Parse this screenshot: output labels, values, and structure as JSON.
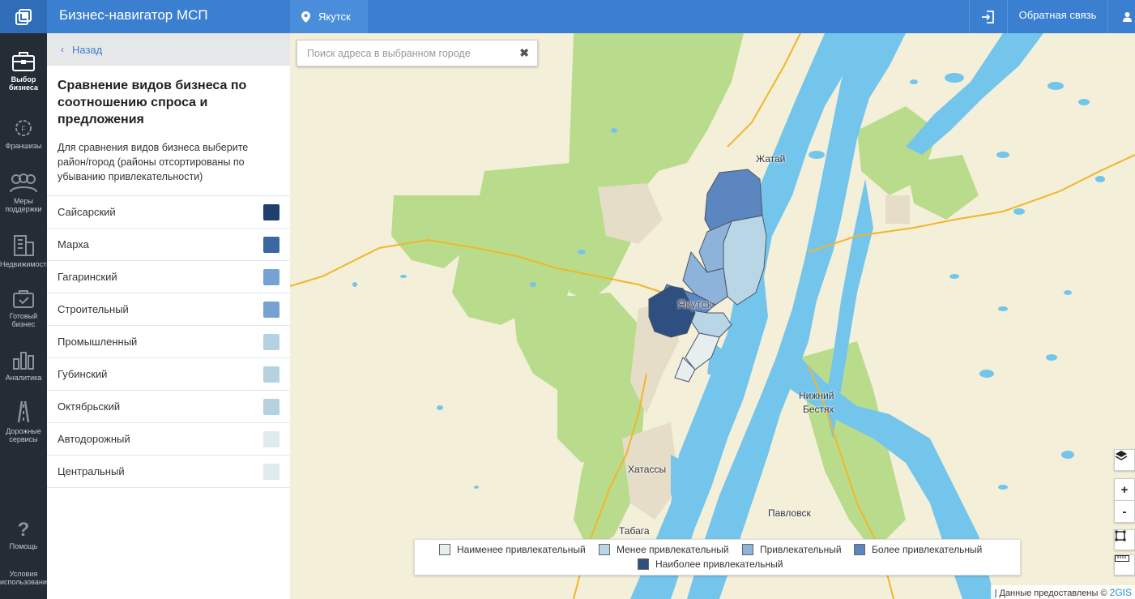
{
  "header": {
    "app_title": "Бизнес-навигатор МСП",
    "city": "Якутск",
    "feedback": "Обратная связь"
  },
  "rail": [
    {
      "label1": "Выбор",
      "label2": "бизнеса",
      "icon": "briefcase-icon",
      "active": true
    },
    {
      "label1": "Франшизы",
      "label2": "",
      "icon": "franchise-gear-icon",
      "active": false
    },
    {
      "label1": "Меры",
      "label2": "поддержки",
      "icon": "people-icon",
      "active": false
    },
    {
      "label1": "Недвижимость",
      "label2": "",
      "icon": "building-icon",
      "active": false
    },
    {
      "label1": "Готовый",
      "label2": "бизнес",
      "icon": "ready-business-icon",
      "active": false
    },
    {
      "label1": "Аналитика",
      "label2": "",
      "icon": "analytics-chart-icon",
      "active": false
    },
    {
      "label1": "Дорожные",
      "label2": "сервисы",
      "icon": "road-icon",
      "active": false
    },
    {
      "label1": "Помощь",
      "label2": "",
      "icon": "help-icon",
      "active": false
    },
    {
      "label1": "Условия",
      "label2": "использования",
      "icon": "",
      "active": false
    }
  ],
  "panel": {
    "back": "Назад",
    "title": "Сравнение видов бизнеса по соотношению спроса и предложения",
    "description": "Для сравнения видов бизнеса выберите район/город (районы отсортированы по убыванию привлекательности)",
    "districts": [
      {
        "name": "Сайсарский",
        "color": "#1f3f6e"
      },
      {
        "name": "Марха",
        "color": "#3c67a4"
      },
      {
        "name": "Гагаринский",
        "color": "#74a3d3"
      },
      {
        "name": "Строительный",
        "color": "#74a3d3"
      },
      {
        "name": "Промышленный",
        "color": "#b4d2e2"
      },
      {
        "name": "Губинский",
        "color": "#b4d2e2"
      },
      {
        "name": "Октябрьский",
        "color": "#b4d2e2"
      },
      {
        "name": "Автодорожный",
        "color": "#e0ebec"
      },
      {
        "name": "Центральный",
        "color": "#e0ebec"
      }
    ]
  },
  "map": {
    "search_placeholder": "Поиск адреса в выбранном городе",
    "places": {
      "zhatai": "Жатай",
      "yakutsk": "Якутск",
      "nizhny_bestyakh_1": "Нижний",
      "nizhny_bestyakh_2": "Бестях",
      "khatassy": "Хатассы",
      "pavlovsk": "Павловск",
      "tabaga": "Табага"
    },
    "legend": [
      {
        "label": "Наименее привлекательный",
        "color": "#e6eef0"
      },
      {
        "label": "Менее привлекательный",
        "color": "#b9d6e6"
      },
      {
        "label": "Привлекательный",
        "color": "#8db3da"
      },
      {
        "label": "Более привлекательный",
        "color": "#5b86c0"
      },
      {
        "label": "Наиболее привлекательный",
        "color": "#2e4f80"
      }
    ],
    "attribution_text": "| Данные предоставлены © ",
    "attribution_brand": "2GIS",
    "zoom_in": "+",
    "zoom_out": "-"
  },
  "colors": {
    "header_blue": "#3b7fd0",
    "rail_dark": "#242c36",
    "water": "#74c5ec",
    "forest": "#b9dc8c",
    "land": "#f4efd9",
    "road": "#f2b52a"
  }
}
